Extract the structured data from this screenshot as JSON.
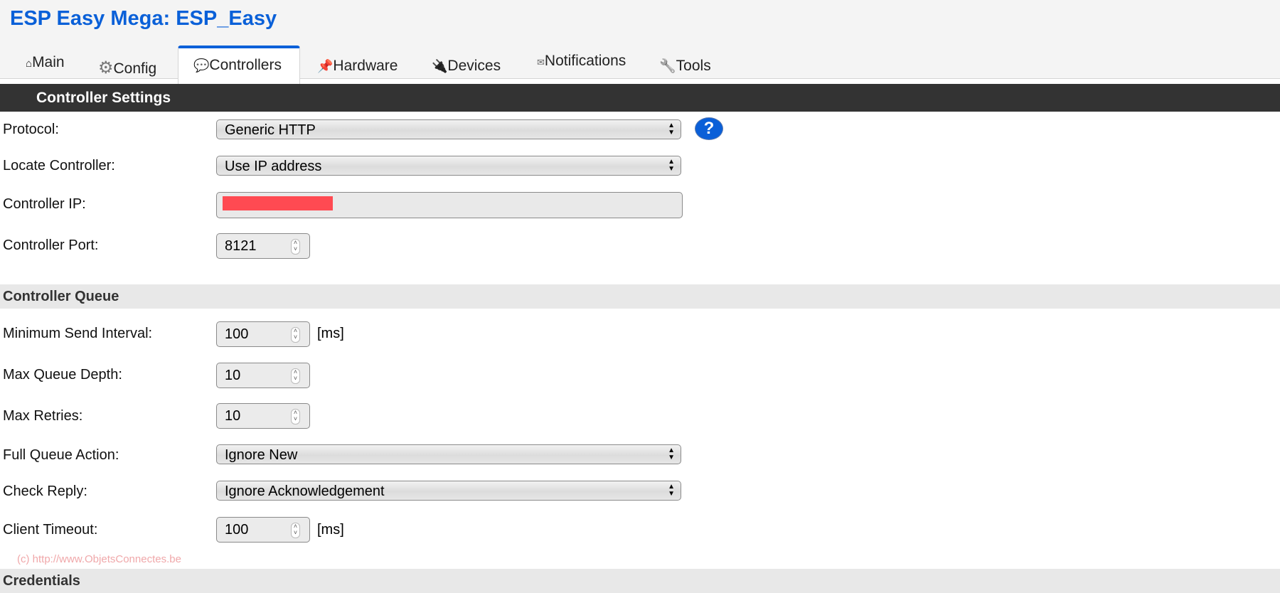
{
  "header": {
    "title": "ESP Easy Mega: ESP_Easy"
  },
  "tabs": [
    {
      "label": "Main",
      "icon": "⌂",
      "icon_name": "home-icon"
    },
    {
      "label": "Config",
      "icon": "⚙",
      "icon_name": "gear-icon"
    },
    {
      "label": "Controllers",
      "icon": "💬",
      "icon_name": "speech-bubble-icon",
      "active": true
    },
    {
      "label": "Hardware",
      "icon": "📌",
      "icon_name": "pushpin-icon"
    },
    {
      "label": "Devices",
      "icon": "🔌",
      "icon_name": "plug-icon"
    },
    {
      "label": "Notifications",
      "icon": "✉",
      "icon_name": "envelope-icon"
    },
    {
      "label": "Tools",
      "icon": "🔧",
      "icon_name": "wrench-icon"
    }
  ],
  "settings": {
    "heading": "Controller Settings",
    "protocol": {
      "label": "Protocol:",
      "value": "Generic HTTP",
      "help": "?"
    },
    "locate": {
      "label": "Locate Controller:",
      "value": "Use IP address"
    },
    "ip": {
      "label": "Controller IP:",
      "value": ""
    },
    "port": {
      "label": "Controller Port:",
      "value": "8121"
    }
  },
  "queue": {
    "heading": "Controller Queue",
    "min_send_interval": {
      "label": "Minimum Send Interval:",
      "value": "100",
      "unit": "[ms]"
    },
    "max_queue_depth": {
      "label": "Max Queue Depth:",
      "value": "10"
    },
    "max_retries": {
      "label": "Max Retries:",
      "value": "10"
    },
    "full_queue_action": {
      "label": "Full Queue Action:",
      "value": "Ignore New"
    },
    "check_reply": {
      "label": "Check Reply:",
      "value": "Ignore Acknowledgement"
    },
    "client_timeout": {
      "label": "Client Timeout:",
      "value": "100",
      "unit": "[ms]"
    }
  },
  "credentials": {
    "heading": "Credentials"
  },
  "watermark": "(c) http://www.ObjetsConnectes.be",
  "colors": {
    "accent": "#0a60d8",
    "bar": "#333333",
    "redaction": "#ff4a52"
  }
}
